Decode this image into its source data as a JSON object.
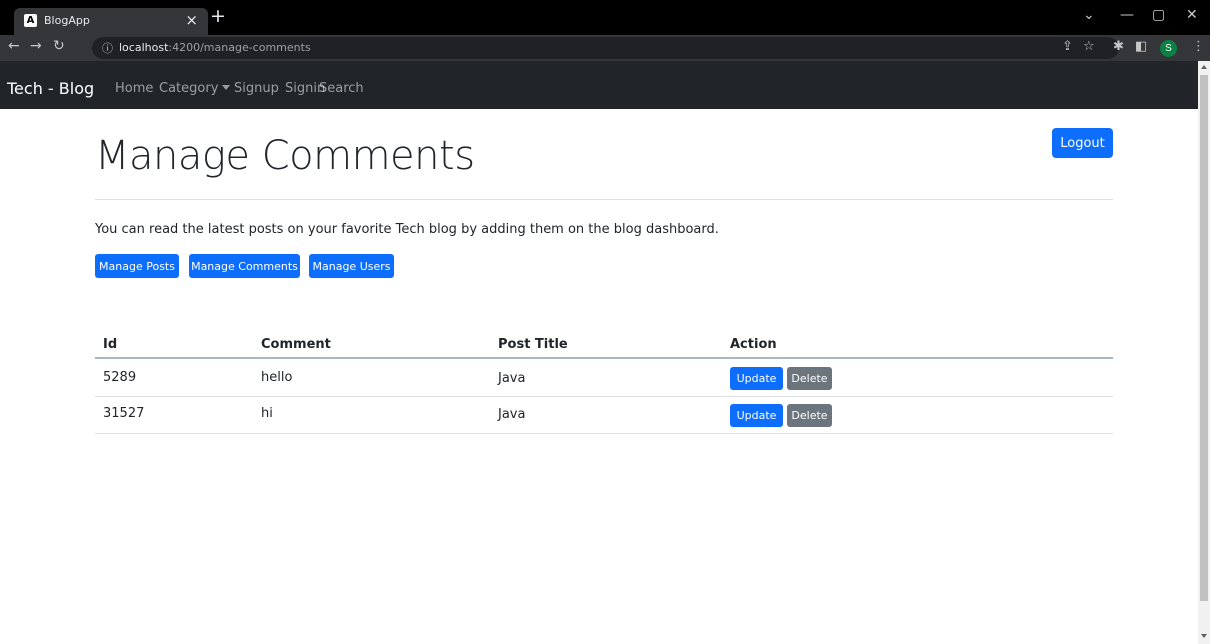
{
  "browser": {
    "tab_title": "BlogApp",
    "tab_favicon": "A",
    "url_host": "localhost",
    "url_path": ":4200/manage-comments",
    "profile_initial": "S"
  },
  "navbar": {
    "brand": "Tech - Blog",
    "links": [
      "Home",
      "Category",
      "Signup",
      "Signin",
      "Search"
    ]
  },
  "page": {
    "title": "Manage Comments",
    "logout_label": "Logout",
    "lead": "You can read the latest posts on your favorite Tech blog by adding them on the blog dashboard.",
    "buttons": [
      "Manage Posts",
      "Manage Comments",
      "Manage Users"
    ]
  },
  "table": {
    "headers": [
      "Id",
      "Comment",
      "Post Title",
      "Action"
    ],
    "rows": [
      {
        "id": "5289",
        "comment": "hello",
        "post_title": "Java"
      },
      {
        "id": "31527",
        "comment": "hi",
        "post_title": "Java"
      }
    ],
    "update_label": "Update",
    "delete_label": "Delete"
  },
  "colors": {
    "primary": "#0d6efd",
    "secondary": "#6c757d",
    "navbar_bg": "#212529"
  },
  "icons": [
    "close-icon",
    "plus-icon",
    "back-arrow-icon",
    "forward-arrow-icon",
    "reload-icon",
    "info-icon",
    "share-icon",
    "star-icon",
    "extensions-icon",
    "sidebar-icon",
    "menu-icon",
    "minimize-icon",
    "maximize-icon",
    "chevron-down-icon"
  ]
}
